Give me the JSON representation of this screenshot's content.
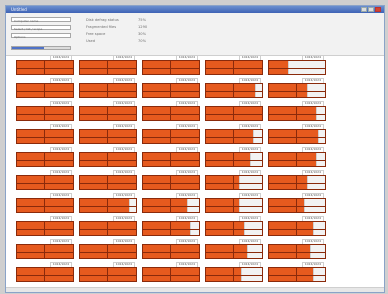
{
  "window": {
    "title": "Untitled",
    "buttons": {
      "minimize": "",
      "maximize": "",
      "close": ""
    }
  },
  "header": {
    "inputs": [
      {
        "value": "Computer name"
      },
      {
        "value": "Select / list / scope"
      },
      {
        "value": "Options"
      }
    ],
    "progress": 0.55,
    "meta": [
      {
        "label": "Disk defrag status",
        "value": "75%"
      },
      {
        "label": "Fragmented files",
        "value": "1290"
      },
      {
        "label": "Free space",
        "value": "30%"
      },
      {
        "label": "Used",
        "value": "70%"
      }
    ]
  },
  "grid": {
    "columns": [
      {
        "tiles": [
          {
            "label": "1024/1024",
            "fill": 1
          },
          {
            "label": "1024/1024",
            "fill": 1
          },
          {
            "label": "1024/1024",
            "fill": 1
          },
          {
            "label": "1024/1024",
            "fill": 1
          },
          {
            "label": "1024/1024",
            "fill": 1
          },
          {
            "label": "1024/1024",
            "fill": 1
          },
          {
            "label": "1024/1024",
            "fill": 1
          },
          {
            "label": "1024/1024",
            "fill": 1
          },
          {
            "label": "1024/1024",
            "fill": 1
          },
          {
            "label": "1024/1024",
            "fill": 1
          }
        ]
      },
      {
        "tiles": [
          {
            "label": "1024/1024",
            "fill": 1
          },
          {
            "label": "1024/1024",
            "fill": 1
          },
          {
            "label": "1024/1024",
            "fill": 1
          },
          {
            "label": "1024/1024",
            "fill": 1
          },
          {
            "label": "1024/1024",
            "fill": 1
          },
          {
            "label": "1024/1024",
            "fill": 1
          },
          {
            "label": "1024/1024",
            "fill": 0.9
          },
          {
            "label": "1024/1024",
            "fill": 1
          },
          {
            "label": "1024/1024",
            "fill": 1
          },
          {
            "label": "1024/1024",
            "fill": 1
          }
        ]
      },
      {
        "tiles": [
          {
            "label": "1024/1024",
            "fill": 1
          },
          {
            "label": "1024/1024",
            "fill": 1
          },
          {
            "label": "1024/1024",
            "fill": 1
          },
          {
            "label": "1024/1024",
            "fill": 1
          },
          {
            "label": "1024/1024",
            "fill": 1
          },
          {
            "label": "1024/1024",
            "fill": 1
          },
          {
            "label": "1024/1024",
            "fill": 0.8
          },
          {
            "label": "1024/1024",
            "fill": 0.85
          },
          {
            "label": "1024/1024",
            "fill": 1
          },
          {
            "label": "1024/1024",
            "fill": 1
          }
        ]
      },
      {
        "tiles": [
          {
            "label": "1024/1024",
            "fill": 1
          },
          {
            "label": "1024/1024",
            "fill": 0.9
          },
          {
            "label": "1024/1024",
            "fill": 1
          },
          {
            "label": "1024/1024",
            "fill": 0.85
          },
          {
            "label": "1024/1024",
            "fill": 0.8
          },
          {
            "label": "1024/1024",
            "fill": 0.6
          },
          {
            "label": "1024/1024",
            "fill": 0.6
          },
          {
            "label": "1024/1024",
            "fill": 0.7
          },
          {
            "label": "1024/1024",
            "fill": 0.75
          },
          {
            "label": "1024/1024",
            "fill": 0.65
          }
        ]
      },
      {
        "tiles": [
          {
            "label": "1024/1024",
            "fill": 0.35
          },
          {
            "label": "1024/1024",
            "fill": 0.7
          },
          {
            "label": "1024/1024",
            "fill": 0.85
          },
          {
            "label": "1024/1024",
            "fill": 0.9
          },
          {
            "label": "1024/1024",
            "fill": 0.85
          },
          {
            "label": "1024/1024",
            "fill": 0.7
          },
          {
            "label": "1024/1024",
            "fill": 0.65
          },
          {
            "label": "1024/1024",
            "fill": 0.8
          },
          {
            "label": "1024/1024",
            "fill": 0.75
          },
          {
            "label": "1024/1024",
            "fill": 0.8
          }
        ]
      }
    ]
  }
}
